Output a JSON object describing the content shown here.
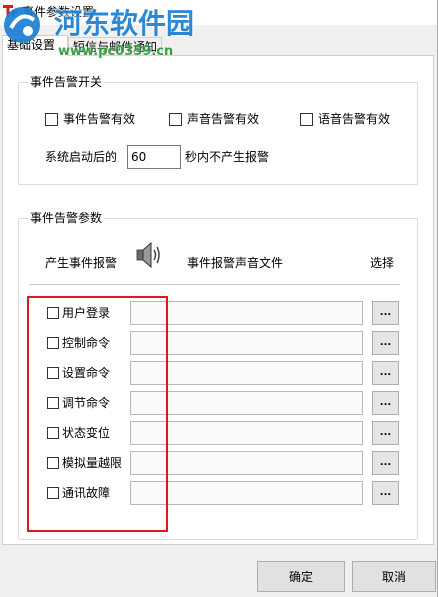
{
  "window": {
    "title": "事件参数设置",
    "icon": "app-icon"
  },
  "watermark": {
    "brand": "河东软件园",
    "url": "www.pc0359.cn",
    "logo": "watermark-logo-icon"
  },
  "tabs": [
    {
      "label": "基础设置",
      "selected": true
    },
    {
      "label": "短信与邮件通知",
      "selected": false
    }
  ],
  "alarm_switch": {
    "title": "事件告警开关",
    "checkboxes": [
      {
        "label": "事件告警有效",
        "checked": false
      },
      {
        "label": "声音告警有效",
        "checked": false
      },
      {
        "label": "语音告警有效",
        "checked": false
      }
    ],
    "startup_prefix": "系统启动后的",
    "startup_seconds": "60",
    "startup_suffix": "秒内不产生报警"
  },
  "alarm_params": {
    "title": "事件告警参数",
    "header_event": "产生事件报警",
    "header_sound_file": "事件报警声音文件",
    "header_choose": "选择",
    "header_icon": "speaker-icon",
    "browse_label": "...",
    "rows": [
      {
        "label": "用户登录",
        "checked": false
      },
      {
        "label": "控制命令",
        "checked": false
      },
      {
        "label": "设置命令",
        "checked": false
      },
      {
        "label": "调节命令",
        "checked": false
      },
      {
        "label": "状态变位",
        "checked": false
      },
      {
        "label": "模拟量越限",
        "checked": false
      },
      {
        "label": "通讯故障",
        "checked": false
      }
    ]
  },
  "buttons": {
    "ok": "确定",
    "cancel": "取消"
  },
  "colors": {
    "annotation": "#e3161e",
    "watermark_blue": "#1b7fd3",
    "watermark_green": "#2e9a3a",
    "dialog_bg": "#f0f0f0"
  }
}
